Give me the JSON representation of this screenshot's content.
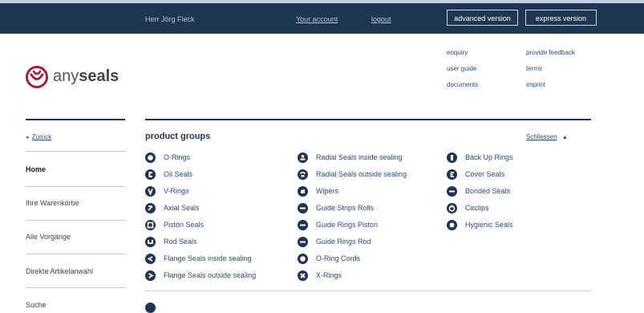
{
  "header": {
    "user_name": "Herr Jörg Fleck",
    "account_link": "Your account",
    "logout_link": "logout",
    "advanced_button": "advanced version",
    "express_button": "express version"
  },
  "logo": {
    "prefix": "any",
    "bold": "seals",
    "brand_color": "#a3203d"
  },
  "header_links": [
    "enquiry",
    "user guide",
    "documents",
    "provide feedback",
    "terms",
    "imprint"
  ],
  "sidebar": {
    "back_label": "Zurück",
    "items": [
      "Home",
      "Ihre Warenkörbe",
      "Alle Vorgänge",
      "Direkte Artikelanwahl",
      "Suche"
    ]
  },
  "main": {
    "title": "product groups",
    "close_label": "Schliessen",
    "close_arrow": "▲",
    "columns": [
      [
        {
          "label": "O-Rings",
          "icon": "o-ring-icon"
        },
        {
          "label": "Oil Seals",
          "icon": "oil-seal-icon"
        },
        {
          "label": "V-Rings",
          "icon": "v-ring-icon"
        },
        {
          "label": "Axial Seals",
          "icon": "axial-seal-icon"
        },
        {
          "label": "Piston Seals",
          "icon": "piston-seal-icon"
        },
        {
          "label": "Rod Seals",
          "icon": "rod-seal-icon"
        },
        {
          "label": "Flange Seals inside sealing",
          "icon": "flange-inside-icon"
        },
        {
          "label": "Flange Seals outside sealing",
          "icon": "flange-outside-icon"
        }
      ],
      [
        {
          "label": "Radial Seals inside sealing",
          "icon": "radial-inside-icon"
        },
        {
          "label": "Radial Seals outside sealing",
          "icon": "radial-outside-icon"
        },
        {
          "label": "Wipers",
          "icon": "wiper-icon"
        },
        {
          "label": "Guide Strips Rolls",
          "icon": "guide-strip-icon"
        },
        {
          "label": "Guide Rings Piston",
          "icon": "guide-ring-piston-icon"
        },
        {
          "label": "Guide Rings Rod",
          "icon": "guide-ring-rod-icon"
        },
        {
          "label": "O-Ring Cords",
          "icon": "o-ring-cord-icon"
        },
        {
          "label": "X-Rings",
          "icon": "x-ring-icon"
        }
      ],
      [
        {
          "label": "Back Up Rings",
          "icon": "back-up-ring-icon"
        },
        {
          "label": "Cover Seals",
          "icon": "cover-seal-icon"
        },
        {
          "label": "Bonded Seals",
          "icon": "bonded-seal-icon"
        },
        {
          "label": "Circlips",
          "icon": "circlip-icon"
        },
        {
          "label": "Hygienic Seals",
          "icon": "hygienic-seal-icon"
        }
      ]
    ]
  }
}
